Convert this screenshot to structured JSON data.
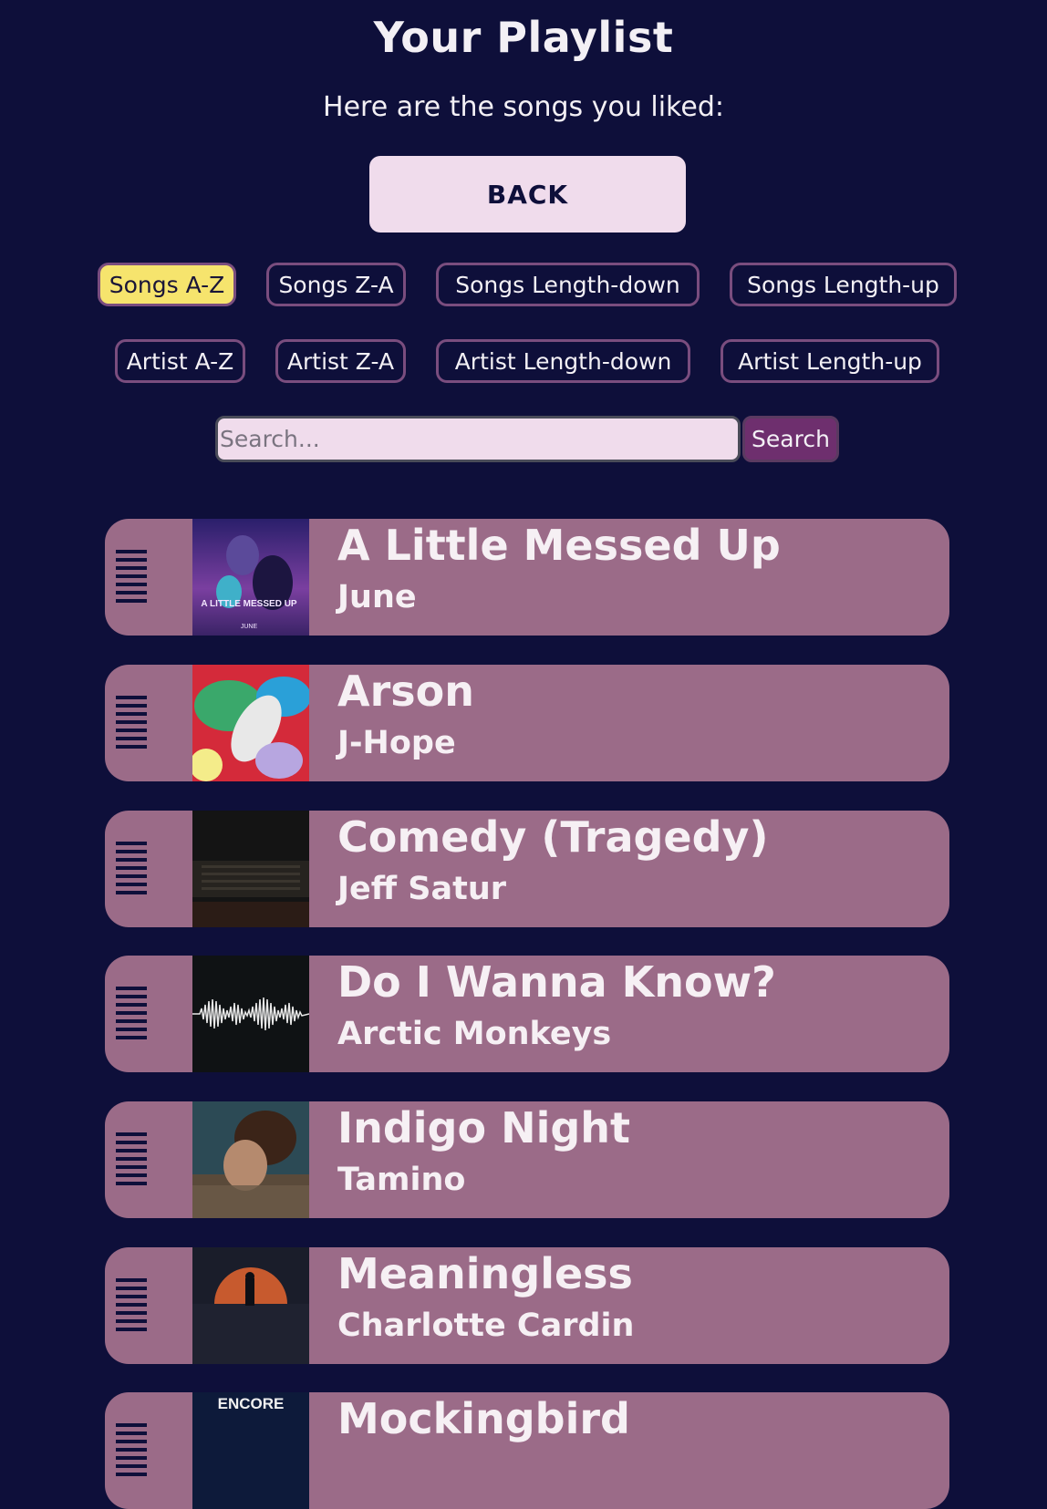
{
  "header": {
    "title": "Your Playlist",
    "subtitle": "Here are the songs you liked:",
    "back_label": "BACK"
  },
  "sort_buttons": {
    "songs_az": "Songs A-Z",
    "songs_za": "Songs Z-A",
    "songs_length_down": "Songs Length-down",
    "songs_length_up": "Songs Length-up",
    "artist_az": "Artist A-Z",
    "artist_za": "Artist Z-A",
    "artist_length_down": "Artist Length-down",
    "artist_length_up": "Artist Length-up",
    "active": "Songs A-Z"
  },
  "search": {
    "placeholder": "Search...",
    "value": "",
    "button_label": "Search"
  },
  "cover_texts": {
    "little_messed_up": "A LITTLE MESSED UP",
    "june": "JUNE",
    "encore": "ENCORE"
  },
  "songs": [
    {
      "title": "A Little Messed Up",
      "artist": "June"
    },
    {
      "title": "Arson",
      "artist": "J-Hope"
    },
    {
      "title": "Comedy (Tragedy)",
      "artist": "Jeff Satur"
    },
    {
      "title": "Do I Wanna Know?",
      "artist": "Arctic Monkeys"
    },
    {
      "title": "Indigo Night",
      "artist": "Tamino"
    },
    {
      "title": "Meaningless",
      "artist": "Charlotte Cardin"
    },
    {
      "title": "Mockingbird",
      "artist": ""
    }
  ],
  "colors": {
    "background": "#0e0f3a",
    "card": "#9b6b88",
    "active_sort": "#f6e46d",
    "button_bg": "#f0dcec",
    "search_button": "#6e2f6e"
  }
}
